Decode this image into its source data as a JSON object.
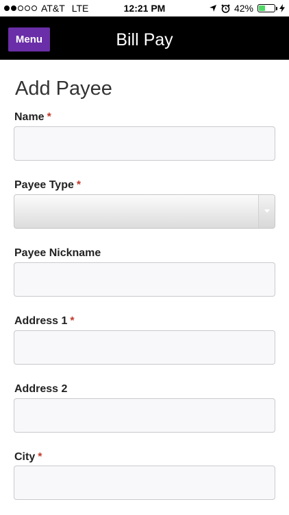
{
  "status_bar": {
    "carrier": "AT&T",
    "network": "LTE",
    "time": "12:21 PM",
    "battery": "42%",
    "battery_level": 0.42
  },
  "header": {
    "menu_label": "Menu",
    "title": "Bill Pay"
  },
  "form": {
    "title": "Add Payee",
    "required_mark": "*",
    "fields": [
      {
        "label": "Name",
        "required": true,
        "value": ""
      },
      {
        "label": "Payee Type",
        "required": true,
        "value": ""
      },
      {
        "label": "Payee Nickname",
        "required": false,
        "value": ""
      },
      {
        "label": "Address 1",
        "required": true,
        "value": ""
      },
      {
        "label": "Address 2",
        "required": false,
        "value": ""
      },
      {
        "label": "City",
        "required": true,
        "value": ""
      }
    ]
  },
  "colors": {
    "menu_button": "#6a2ea8",
    "header_bg": "#000000",
    "required": "#c0392b",
    "battery": "#4cd964"
  }
}
